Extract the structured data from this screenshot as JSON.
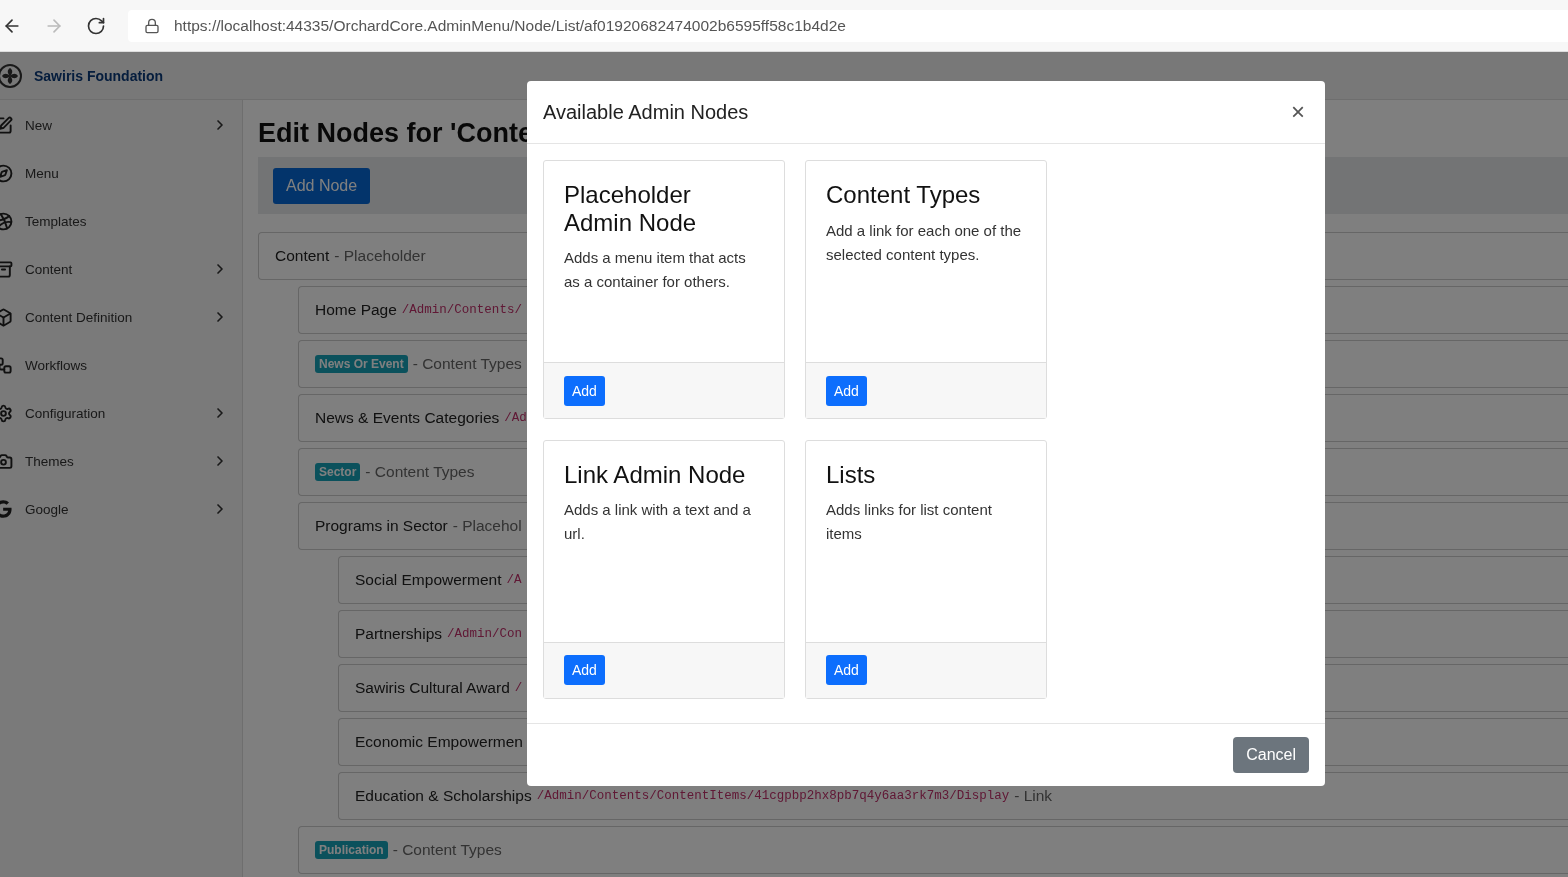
{
  "browser": {
    "back_enabled": true,
    "forward_enabled": false,
    "url": "https://localhost:44335/OrchardCore.AdminMenu/Node/List/af01920682474002b6595ff58c1b4d2e"
  },
  "brand": {
    "name": "Sawiris Foundation"
  },
  "sidebar": {
    "items": [
      {
        "label": "New",
        "has_children": true
      },
      {
        "label": "Menu",
        "has_children": false
      },
      {
        "label": "Templates",
        "has_children": false
      },
      {
        "label": "Content",
        "has_children": true
      },
      {
        "label": "Content Definition",
        "has_children": true
      },
      {
        "label": "Workflows",
        "has_children": false
      },
      {
        "label": "Configuration",
        "has_children": true
      },
      {
        "label": "Themes",
        "has_children": true
      },
      {
        "label": "Google",
        "has_children": true
      }
    ]
  },
  "page": {
    "title": "Edit Nodes for 'Conte",
    "add_button": "Add Node",
    "nodes": [
      {
        "text": "Content",
        "type_label": "- Placeholder",
        "children": [
          {
            "text": "Home Page",
            "url": "/Admin/Contents/"
          },
          {
            "badge": "News Or Event",
            "type_label": "- Content Types"
          },
          {
            "text": "News & Events Categories",
            "url": "/Ad"
          },
          {
            "badge": "Sector",
            "type_label": "- Content Types"
          },
          {
            "text": "Programs in Sector",
            "type_label": "- Placehol",
            "children": [
              {
                "text": "Social Empowerment",
                "url": "/A"
              },
              {
                "text": "Partnerships",
                "url": "/Admin/Con"
              },
              {
                "text": "Sawiris Cultural Award",
                "url": "/"
              },
              {
                "text": "Economic Empowermen"
              },
              {
                "text": "Education & Scholarships",
                "url": "/Admin/Contents/ContentItems/41cgpbp2hx8pb7q4y6aa3rk7m3/Display",
                "type_label": "- Link"
              }
            ]
          },
          {
            "badge": "Publication",
            "type_label": "- Content Types"
          }
        ]
      }
    ]
  },
  "modal": {
    "title": "Available Admin Nodes",
    "close": "×",
    "cards": [
      {
        "title": "Placeholder Admin Node",
        "description": "Adds a menu item that acts as a container for others.",
        "button": "Add"
      },
      {
        "title": "Content Types",
        "description": "Add a link for each one of the selected content types.",
        "button": "Add"
      },
      {
        "title": "Link Admin Node",
        "description": "Adds a link with a text and a url.",
        "button": "Add"
      },
      {
        "title": "Lists",
        "description": "Adds links for list content items",
        "button": "Add"
      }
    ],
    "cancel": "Cancel"
  }
}
